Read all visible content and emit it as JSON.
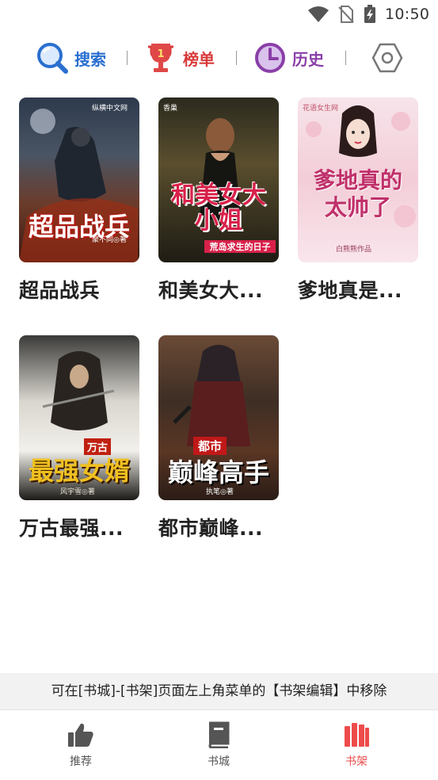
{
  "status_bar": {
    "time": "10:50",
    "icons": [
      "wifi-icon",
      "no-sim-icon",
      "battery-charging-icon"
    ]
  },
  "top_nav": {
    "items": [
      {
        "label": "搜索",
        "icon": "search-icon",
        "color": "#2a6fd0"
      },
      {
        "label": "榜单",
        "icon": "trophy-icon",
        "color": "#d83a3a"
      },
      {
        "label": "历史",
        "icon": "clock-icon",
        "color": "#8a3fa8"
      }
    ],
    "settings_icon": "settings-hexagon-icon"
  },
  "books": [
    {
      "title": "超品战兵",
      "cover_title": "超品战兵",
      "cover_author": "聚不同◎著",
      "cover_badge": "纵横中文网"
    },
    {
      "title": "和美女大...",
      "cover_title": "和美女大小姐",
      "cover_subtitle": "荒岛求生的日子",
      "cover_badge": "香巢"
    },
    {
      "title": "爹地真是...",
      "cover_title": "爹地真的太帅了",
      "cover_author": "白熊熊作品",
      "cover_badge": "花语女生网"
    },
    {
      "title": "万古最强...",
      "cover_title": "最强女婿",
      "cover_tag": "万古",
      "cover_author": "风宇雪◎著"
    },
    {
      "title": "都市巅峰...",
      "cover_title": "巅峰高手",
      "cover_tag": "都市",
      "cover_author": "执笔◎著"
    }
  ],
  "hint": "可在[书城]-[书架]页面左上角菜单的【书架编辑】中移除",
  "tab_bar": {
    "tabs": [
      {
        "label": "推荐",
        "icon": "thumbs-up-icon",
        "active": false
      },
      {
        "label": "书城",
        "icon": "book-icon",
        "active": false
      },
      {
        "label": "书架",
        "icon": "bookshelf-icon",
        "active": true
      }
    ],
    "active_color": "#ee4b4b",
    "inactive_color": "#555555"
  }
}
